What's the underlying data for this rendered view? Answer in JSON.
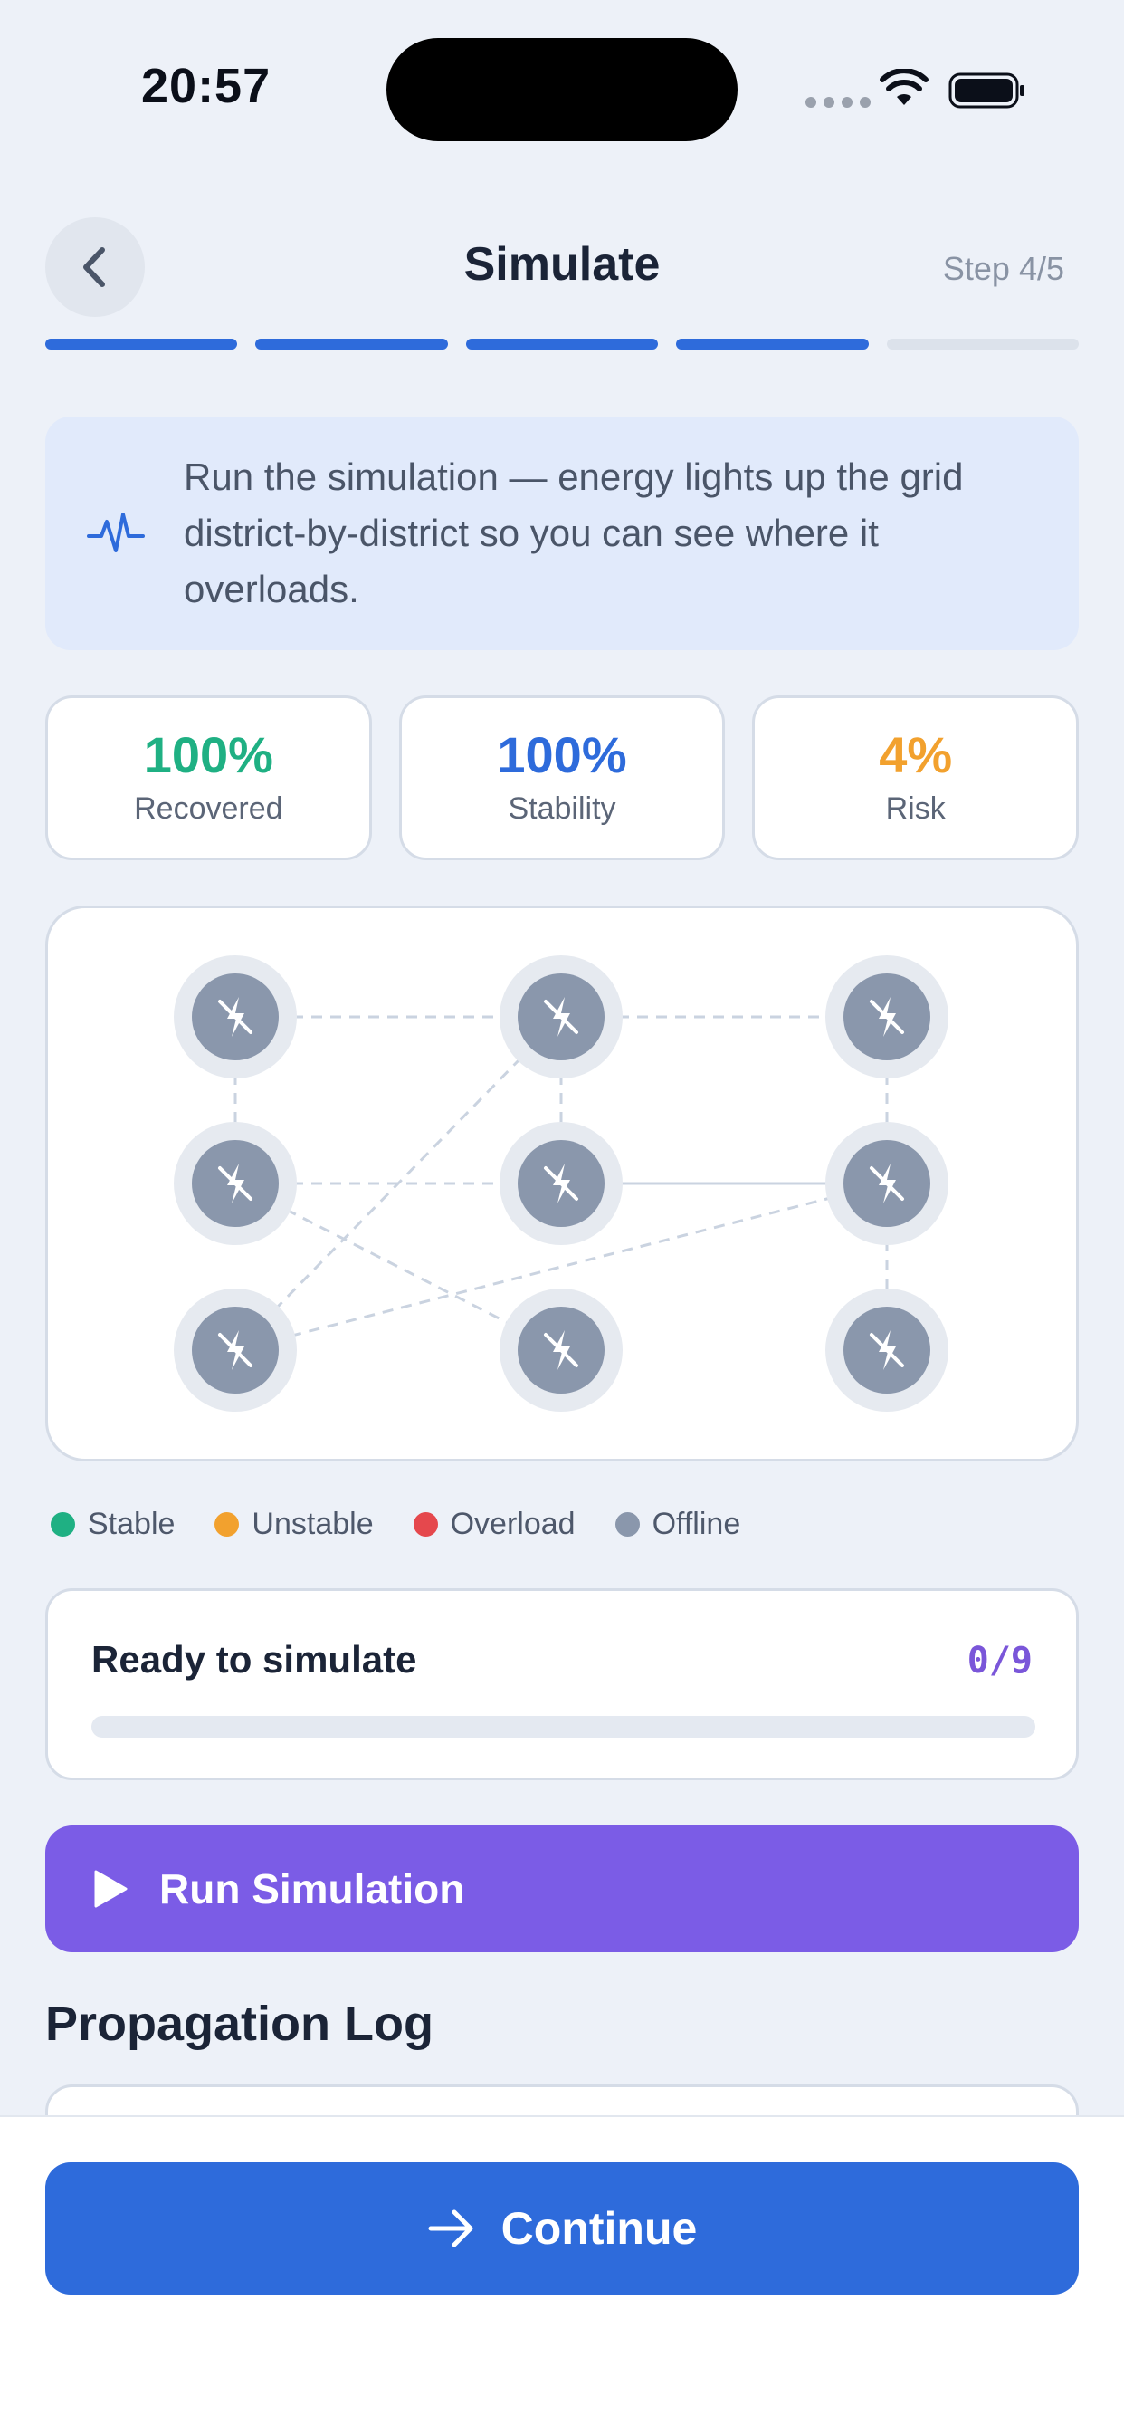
{
  "status_bar": {
    "time": "20:57",
    "icons": [
      "cellular-signal-icon",
      "wifi-icon",
      "battery-icon"
    ]
  },
  "header": {
    "back_icon": "chevron-left-icon",
    "title": "Simulate",
    "step": "Step 4/5"
  },
  "progress": {
    "total_steps": 5,
    "completed_steps": 4,
    "active_color": "#2E6BDB",
    "pending_color": "#DCE2EB"
  },
  "info": {
    "icon": "pulse-icon",
    "text": "Run the simulation — energy lights up the grid district-by-district so you can see where it overloads."
  },
  "stats": [
    {
      "value": "100%",
      "label": "Recovered",
      "color": "#1FB083"
    },
    {
      "value": "100%",
      "label": "Stability",
      "color": "#2E6BDB"
    },
    {
      "value": "4%",
      "label": "Risk",
      "color": "#F2A12E"
    }
  ],
  "grid": {
    "node_icon": "power-off-icon",
    "node_state": "Offline",
    "node_color": "#8A97AC",
    "nodes": [
      {
        "id": "n1",
        "row": 0,
        "col": 0
      },
      {
        "id": "n2",
        "row": 0,
        "col": 1
      },
      {
        "id": "n3",
        "row": 0,
        "col": 2
      },
      {
        "id": "n4",
        "row": 1,
        "col": 0
      },
      {
        "id": "n5",
        "row": 1,
        "col": 1
      },
      {
        "id": "n6",
        "row": 1,
        "col": 2
      },
      {
        "id": "n7",
        "row": 2,
        "col": 0
      },
      {
        "id": "n8",
        "row": 2,
        "col": 1
      },
      {
        "id": "n9",
        "row": 2,
        "col": 2
      }
    ],
    "links": [
      {
        "from": "n1",
        "to": "n2",
        "style": "dashed"
      },
      {
        "from": "n2",
        "to": "n3",
        "style": "dashed"
      },
      {
        "from": "n1",
        "to": "n4",
        "style": "dashed"
      },
      {
        "from": "n2",
        "to": "n5",
        "style": "dashed"
      },
      {
        "from": "n3",
        "to": "n6",
        "style": "dashed"
      },
      {
        "from": "n4",
        "to": "n5",
        "style": "dashed"
      },
      {
        "from": "n5",
        "to": "n6",
        "style": "solid"
      },
      {
        "from": "n6",
        "to": "n9",
        "style": "dashed"
      },
      {
        "from": "n2",
        "to": "n7",
        "style": "dashed"
      },
      {
        "from": "n4",
        "to": "n8",
        "style": "dashed"
      },
      {
        "from": "n7",
        "to": "n6",
        "style": "dashed"
      }
    ]
  },
  "legend": [
    {
      "label": "Stable",
      "color": "#1FB083"
    },
    {
      "label": "Unstable",
      "color": "#F2A12E"
    },
    {
      "label": "Overload",
      "color": "#E5484D"
    },
    {
      "label": "Offline",
      "color": "#8A97AC"
    }
  ],
  "simulation": {
    "status": "Ready to simulate",
    "count": "0/9",
    "progress": 0
  },
  "run_button": {
    "icon": "play-icon",
    "label": "Run Simulation"
  },
  "log": {
    "title": "Propagation Log"
  },
  "continue_button": {
    "icon": "arrow-right-icon",
    "label": "Continue"
  }
}
